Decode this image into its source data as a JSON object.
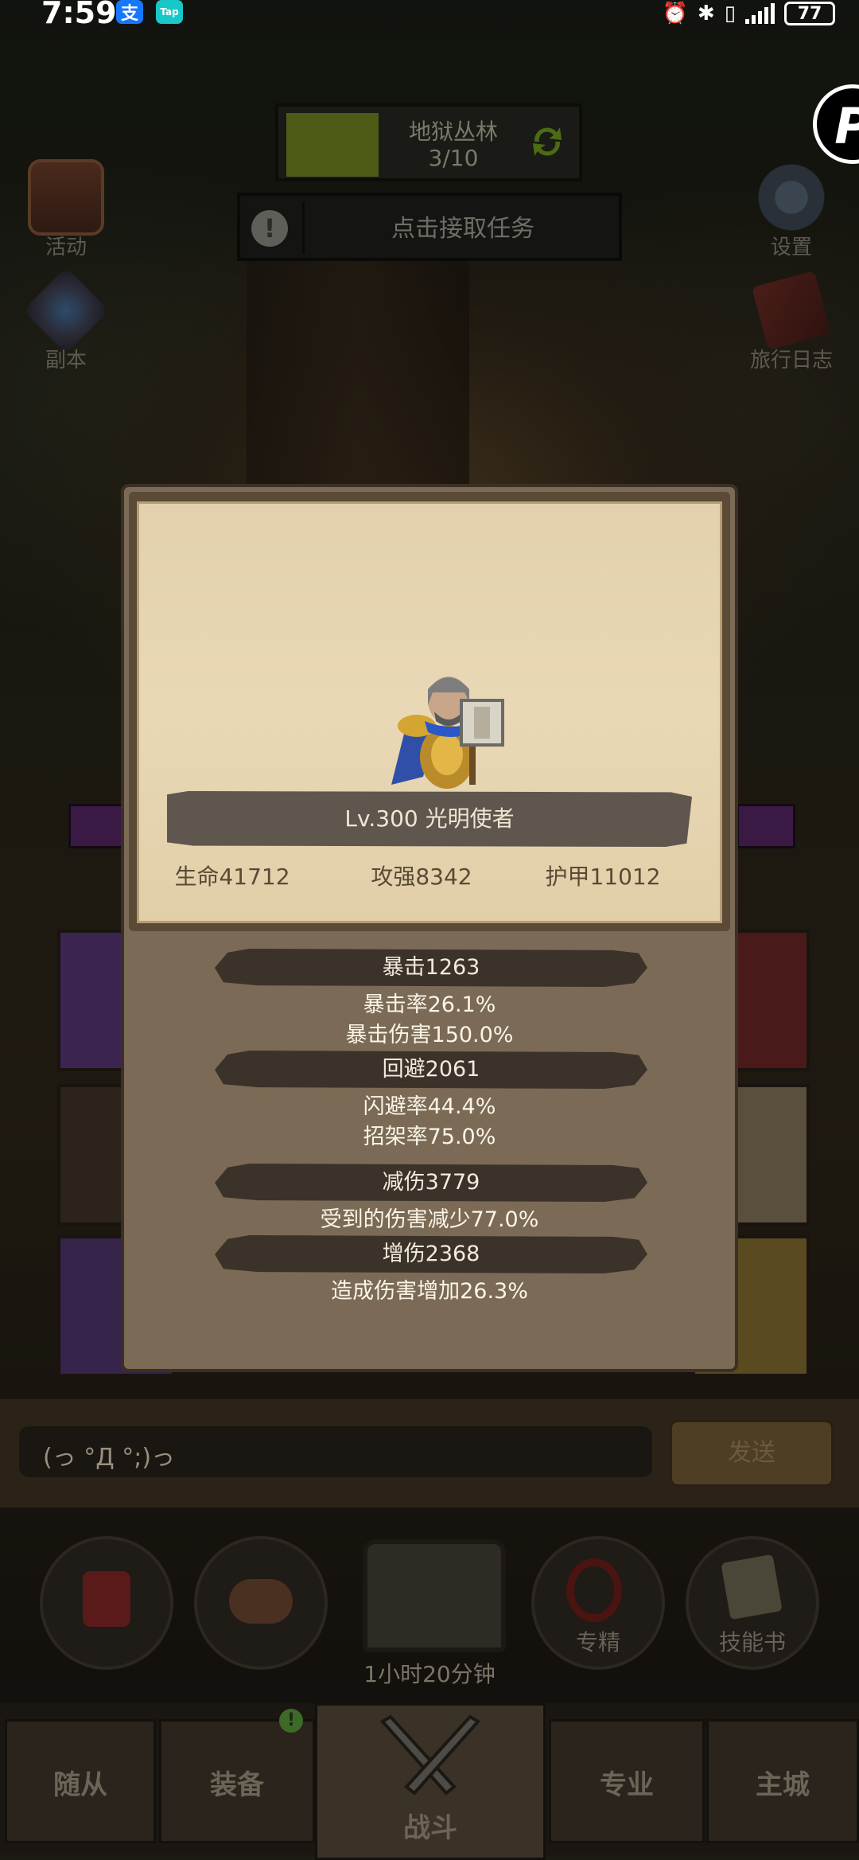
{
  "status_bar": {
    "time": "7:59",
    "alipay_icon": "支",
    "taptap_icon": "Tap",
    "battery": "77"
  },
  "hud": {
    "stage_name": "地狱丛林",
    "stage_count": "3/10",
    "quest_label": "点击接取任务",
    "quest_alert": "!",
    "left_buttons": [
      {
        "label": "活动",
        "icon": "activity-board-icon"
      },
      {
        "label": "副本",
        "icon": "dungeon-portal-icon"
      }
    ],
    "right_buttons": [
      {
        "label": "设置",
        "icon": "gear-icon"
      },
      {
        "label": "旅行日志",
        "icon": "journal-book-icon"
      }
    ],
    "floating_badge": "P"
  },
  "hero_card": {
    "name_line": "Lv.300 光明使者",
    "main_stats": {
      "hp": "生命41712",
      "attack": "攻强8342",
      "armor": "护甲11012"
    },
    "sections": [
      {
        "title": "暴击1263",
        "lines": [
          "暴击率26.1%",
          "暴击伤害150.0%"
        ]
      },
      {
        "title": "回避2061",
        "lines": [
          "闪避率44.4%",
          "招架率75.0%"
        ]
      },
      {
        "title": "减伤3779",
        "lines": [
          "受到的伤害减少77.0%"
        ]
      },
      {
        "title": "增伤2368",
        "lines": [
          "造成伤害增加26.3%"
        ]
      }
    ]
  },
  "chat": {
    "input_text": "(っ °Д °;)っ",
    "send_label": "发送"
  },
  "skill_row": {
    "timer": "1小时20分钟",
    "slots": [
      {
        "label": "",
        "icon": "potion-icon"
      },
      {
        "label": "",
        "icon": "bread-icon"
      },
      {
        "label": "",
        "icon": "treasure-chest-icon"
      },
      {
        "label": "专精",
        "icon": "mastery-icon"
      },
      {
        "label": "技能书",
        "icon": "skill-book-icon"
      }
    ]
  },
  "bottom_nav": {
    "tabs": [
      "随从",
      "装备",
      "战斗",
      "专业",
      "主城"
    ],
    "equipment_badge": "!"
  },
  "colors": {
    "modal_frame": "#7b6a55",
    "parchment": "#e9d8b6",
    "banner_dark": "#3b3229",
    "stage_progress": "#4c5c17"
  }
}
